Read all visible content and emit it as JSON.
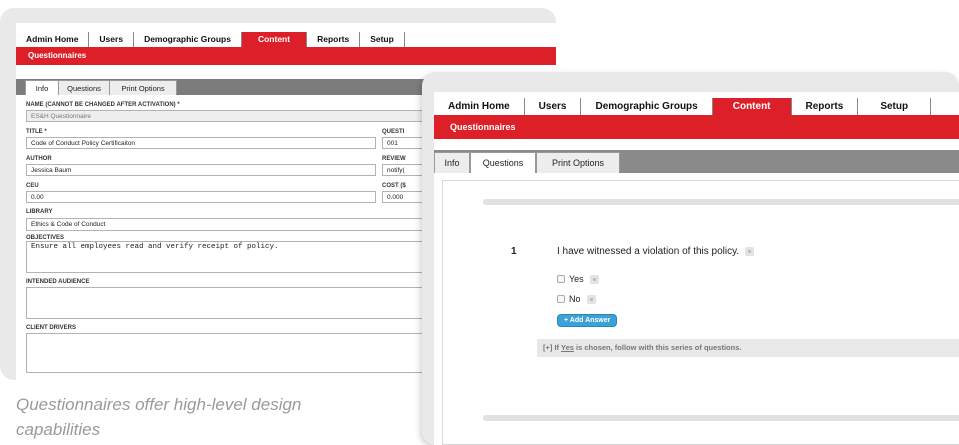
{
  "nav": [
    "Admin Home",
    "Users",
    "Demographic Groups",
    "Content",
    "Reports",
    "Setup"
  ],
  "active_tab": "Content",
  "section_title": "Questionnaires",
  "subtabs": [
    "Info",
    "Questions",
    "Print Options"
  ],
  "info_form": {
    "name_label": "NAME (CANNOT BE CHANGED AFTER ACTIVATION) *",
    "name_value": "ES&H Questionnaire",
    "title_label": "TITLE *",
    "title_value": "Code of Conduct Policy Certificaiton",
    "question_label": "QUESTI",
    "question_value": "001",
    "author_label": "AUTHOR",
    "author_value": "Jessica Baum",
    "review_label": "REVIEW",
    "review_value": "notify(",
    "ceu_label": "CEU",
    "ceu_value": "0.00",
    "cost_label": "COST ($",
    "cost_value": "0.000",
    "library_label": "LIBRARY",
    "library_value": "Ethics & Code of Conduct",
    "objectives_label": "OBJECTIVES",
    "objectives_value": "Ensure all employees read and verify receipt of policy.",
    "audience_label": "INTENDED AUDIENCE",
    "drivers_label": "CLIENT DRIVERS"
  },
  "question": {
    "number": "1",
    "text": "I have witnessed a violation of this policy.",
    "answers": [
      "Yes",
      "No"
    ],
    "add_answer": "+ Add Answer",
    "follow_prefix": "[+]  If",
    "follow_answer": "Yes",
    "follow_suffix": "is chosen, follow with this series of questions."
  },
  "caption": "Questionnaires offer high-level design capabilities",
  "colors": {
    "brand_red": "#dd2027",
    "add_button": "#3ba2d8"
  }
}
